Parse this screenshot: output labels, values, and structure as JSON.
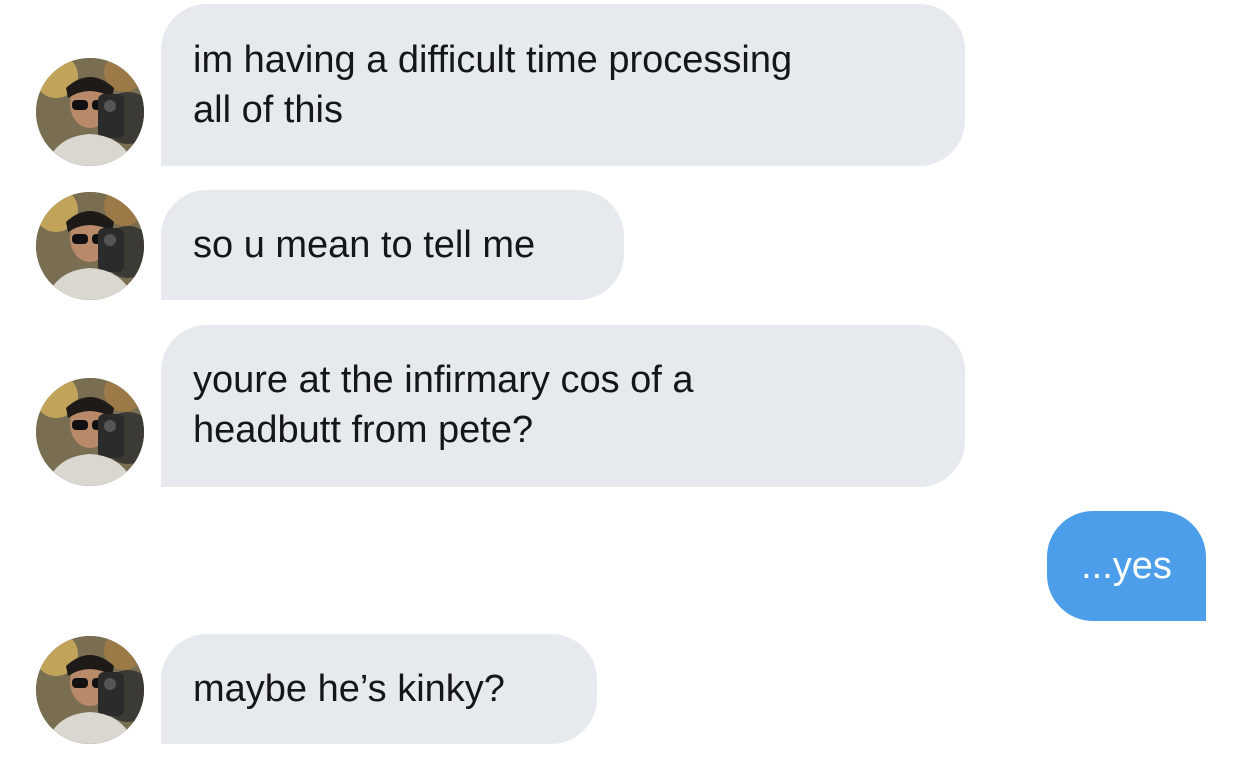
{
  "thread": {
    "messages": [
      {
        "sender": "them",
        "lines": [
          "im having a difficult time processing",
          "all of this"
        ]
      },
      {
        "sender": "them",
        "lines": [
          "so u mean to tell me"
        ]
      },
      {
        "sender": "them",
        "lines": [
          "youre at the infirmary cos of a",
          "headbutt from pete?"
        ]
      },
      {
        "sender": "me",
        "lines": [
          "...yes"
        ]
      },
      {
        "sender": "them",
        "lines": [
          "maybe he’s kinky?"
        ]
      }
    ]
  },
  "colors": {
    "incoming_bubble": "#e6e9ee",
    "outgoing_bubble": "#4c9eeb",
    "incoming_text": "#14171a",
    "outgoing_text": "#ffffff"
  },
  "icons": {
    "avatar": "contact-avatar-photo"
  }
}
